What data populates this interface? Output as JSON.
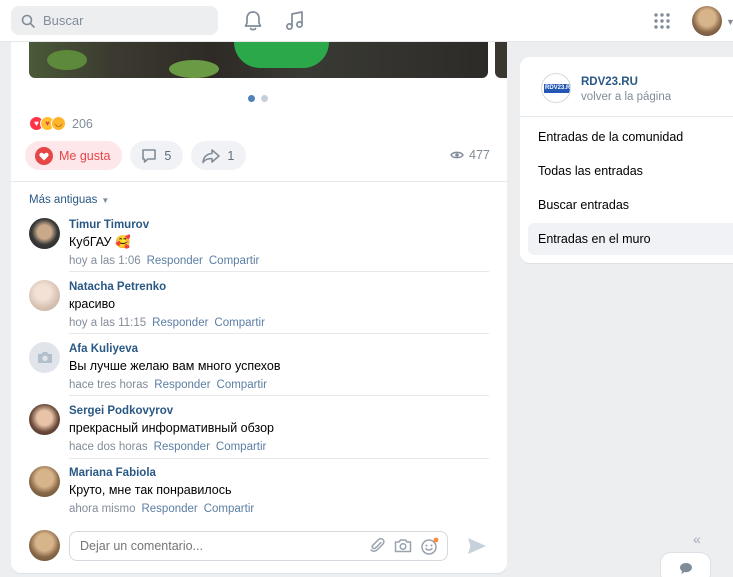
{
  "topbar": {
    "search_placeholder": "Buscar",
    "icons": [
      "search-icon",
      "bell-icon",
      "music-icon",
      "apps-grid-icon",
      "chevron-down-icon"
    ]
  },
  "post": {
    "reactions": {
      "emojis": [
        "heart",
        "heart-eyes",
        "laughing"
      ],
      "count": "206"
    },
    "like_label": "Me gusta",
    "comments_count": "5",
    "shares_count": "1",
    "views_count": "477",
    "carousel": {
      "total": 2,
      "active": 1
    }
  },
  "comments": {
    "older_label": "Más antiguas",
    "reply_label": "Responder",
    "share_label": "Compartir",
    "items": [
      {
        "name": "Timur Timurov",
        "text": "КубГАУ 🥰",
        "time": "hoy a las 1:06"
      },
      {
        "name": "Natacha Petrenko",
        "text": "красиво",
        "time": "hoy a las 11:15"
      },
      {
        "name": "Afa Kuliyeva",
        "text": "Вы лучше желаю вам много успехов",
        "time": "hace tres horas"
      },
      {
        "name": "Sergei Podkovyrov",
        "text": "прекрасный информативный обзор",
        "time": "hace dos horas"
      },
      {
        "name": "Mariana Fabiola",
        "text": "Круто, мне так понравилось",
        "time": "ahora mismo"
      }
    ]
  },
  "composer": {
    "placeholder": "Dejar un comentario..."
  },
  "sidebar": {
    "community_name": "RDV23.RU",
    "logo_text": "RDV23.RU",
    "back_label": "volver a la página",
    "items": [
      {
        "label": "Entradas de la comunidad",
        "active": false
      },
      {
        "label": "Todas las entradas",
        "active": false
      },
      {
        "label": "Buscar entradas",
        "active": false
      },
      {
        "label": "Entradas en el muro",
        "active": true
      }
    ]
  },
  "colors": {
    "link": "#2a5885",
    "accent": "#2a7bd5",
    "like_red": "#e64646",
    "muted": "#818c99",
    "background": "#edeef0"
  }
}
